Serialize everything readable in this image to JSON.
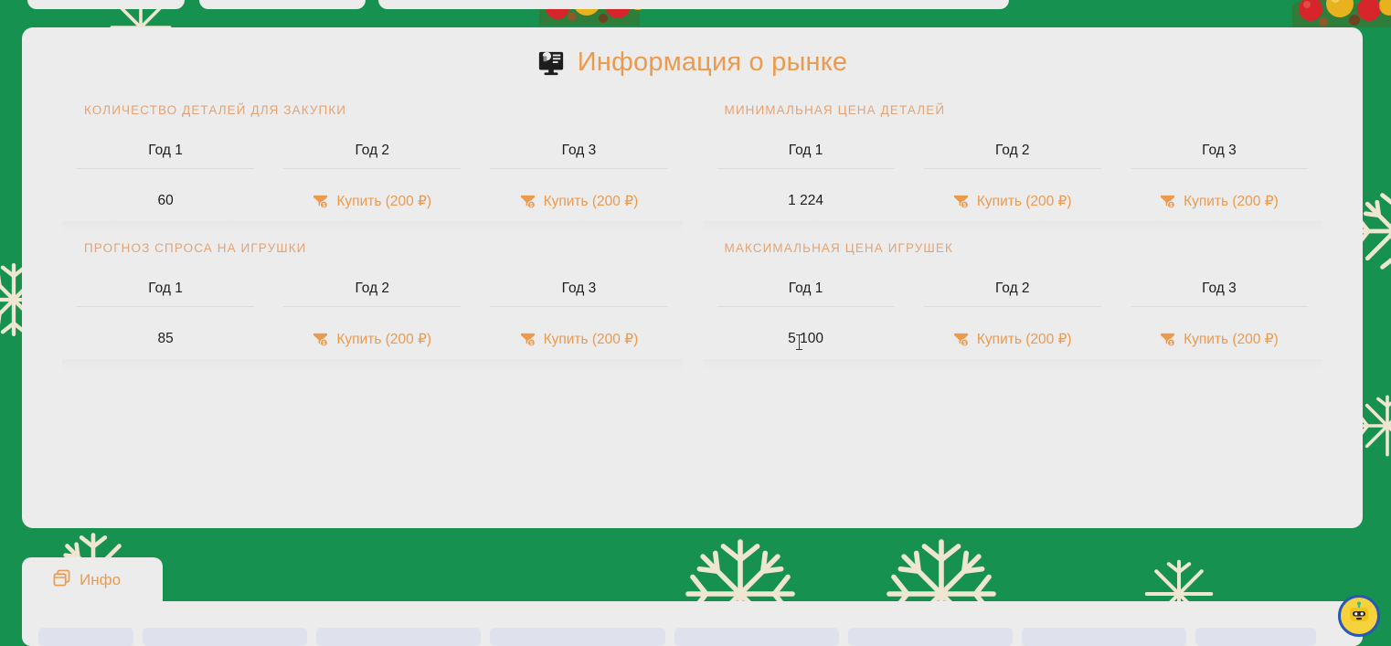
{
  "theme": {
    "background_green": "#17914f",
    "panel_grey": "#ececec",
    "accent_orange": "#eb9a4e",
    "label_orange": "#e2a477",
    "text_dark": "#1d1d1d",
    "snow_cream": "#efe6d2",
    "placeholder_blue": "#dfe2ed"
  },
  "header": {
    "title": "Информация о рынке",
    "icon": "presentation-chart-icon"
  },
  "metrics": [
    {
      "label": "КОЛИЧЕСТВО ДЕТАЛЕЙ ДЛЯ ЗАКУПКИ",
      "name": "parts-purchase-quantity",
      "columns": [
        {
          "head": "Год 1",
          "value": "60",
          "locked": false
        },
        {
          "head": "Год 2",
          "value": "Купить (200 ₽)",
          "locked": true
        },
        {
          "head": "Год 3",
          "value": "Купить (200 ₽)",
          "locked": true
        }
      ]
    },
    {
      "label": "МИНИМАЛЬНАЯ ЦЕНА ДЕТАЛЕЙ",
      "name": "minimum-parts-price",
      "columns": [
        {
          "head": "Год 1",
          "value": "1 224",
          "locked": false
        },
        {
          "head": "Год 2",
          "value": "Купить (200 ₽)",
          "locked": true
        },
        {
          "head": "Год 3",
          "value": "Купить (200 ₽)",
          "locked": true
        }
      ]
    },
    {
      "label": "ПРОГНОЗ СПРОСА НА ИГРУШКИ",
      "name": "toy-demand-forecast",
      "columns": [
        {
          "head": "Год 1",
          "value": "85",
          "locked": false
        },
        {
          "head": "Год 2",
          "value": "Купить (200 ₽)",
          "locked": true
        },
        {
          "head": "Год 3",
          "value": "Купить (200 ₽)",
          "locked": true
        }
      ]
    },
    {
      "label": "МАКСИМАЛЬНАЯ ЦЕНА ИГРУШЕК",
      "name": "maximum-toy-price",
      "columns": [
        {
          "head": "Год 1",
          "value": "5 100",
          "locked": false
        },
        {
          "head": "Год 2",
          "value": "Купить (200 ₽)",
          "locked": true
        },
        {
          "head": "Год 3",
          "value": "Купить (200 ₽)",
          "locked": true
        }
      ]
    }
  ],
  "buy_button": {
    "icon": "funnel-dollar-icon",
    "label": "Купить (200 ₽)",
    "price": "200",
    "currency": "₽"
  },
  "tabs": [
    {
      "label": "Инфо",
      "icon": "clone-windows-icon",
      "active": true
    }
  ],
  "chat": {
    "icon": "robot-icon",
    "name": "chat-assistant-button"
  },
  "decorations": {
    "snowflakes": "❋",
    "ornament": "christmas-ornament-cluster"
  },
  "lower_panel": {
    "placeholder_widths": [
      104,
      180,
      180,
      192,
      180,
      180,
      180,
      132
    ]
  }
}
